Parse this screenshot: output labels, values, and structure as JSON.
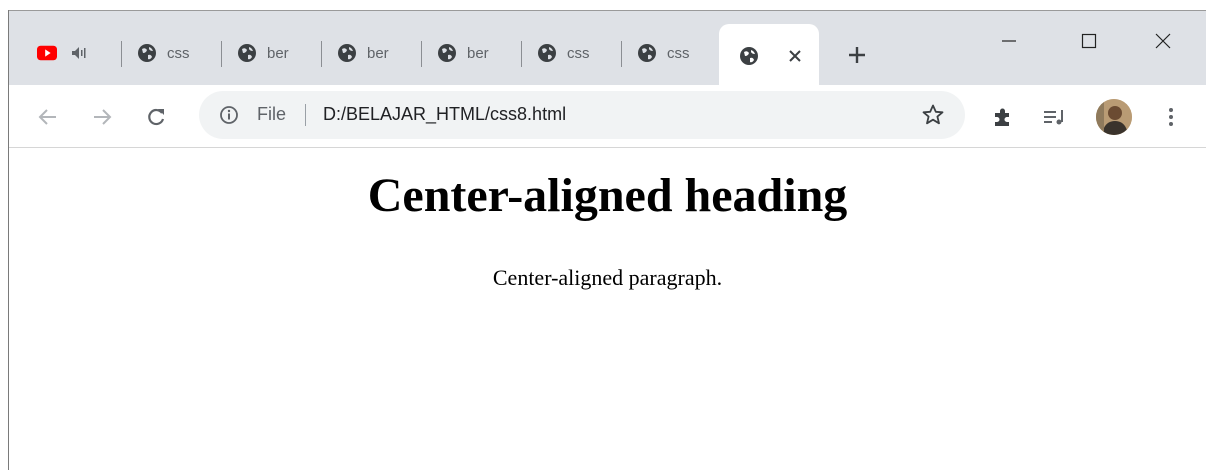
{
  "browser": {
    "tabs": [
      {
        "title": "",
        "icon": "youtube-icon",
        "audio": true
      },
      {
        "title": "css",
        "icon": "globe-icon"
      },
      {
        "title": "ber",
        "icon": "globe-icon"
      },
      {
        "title": "ber",
        "icon": "globe-icon"
      },
      {
        "title": "ber",
        "icon": "globe-icon"
      },
      {
        "title": "css",
        "icon": "globe-icon"
      },
      {
        "title": "css",
        "icon": "globe-icon"
      }
    ],
    "active_tab": {
      "icon": "globe-icon"
    },
    "address_bar": {
      "scheme_label": "File",
      "url": "D:/BELAJAR_HTML/css8.html"
    }
  },
  "page": {
    "heading": "Center-aligned heading",
    "paragraph": "Center-aligned paragraph."
  },
  "colors": {
    "tabstrip": "#dee1e6",
    "omnibox": "#f1f3f4",
    "youtube_red": "#ff0000",
    "icon_gray": "#5f6368"
  }
}
